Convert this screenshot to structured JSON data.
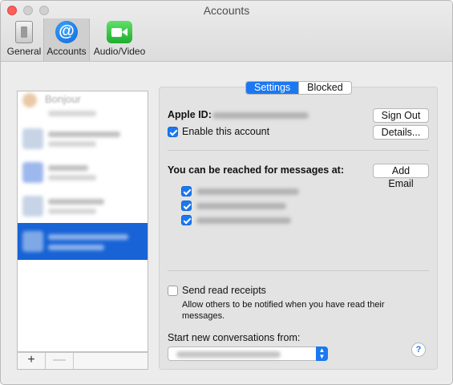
{
  "window": {
    "title": "Accounts"
  },
  "toolbar": {
    "items": [
      {
        "label": "General",
        "icon": "general-switch-icon"
      },
      {
        "label": "Accounts",
        "icon": "at-sign-icon",
        "selected": true
      },
      {
        "label": "Audio/Video",
        "icon": "video-camera-icon"
      }
    ]
  },
  "sidebar": {
    "accounts": [
      {
        "label": "Bonjour"
      },
      {},
      {},
      {},
      {},
      {
        "selected": true
      }
    ],
    "add_label": "+",
    "remove_label": "—"
  },
  "panel": {
    "tabs": [
      {
        "label": "Settings",
        "selected": true
      },
      {
        "label": "Blocked"
      }
    ],
    "apple_id_label": "Apple ID:",
    "sign_out_label": "Sign Out",
    "enable_account_label": "Enable this account",
    "enable_account_checked": true,
    "details_label": "Details...",
    "reached_label": "You can be reached for messages at:",
    "add_email_label": "Add Email",
    "reach_addresses_checked": [
      true,
      true,
      true
    ],
    "send_receipts_label": "Send read receipts",
    "send_receipts_checked": false,
    "receipts_desc": "Allow others to be notified when you have read their messages.",
    "start_conv_label": "Start new conversations from:",
    "help_label": "?"
  },
  "colors": {
    "accent": "#1b78f2",
    "selection": "#1863d6",
    "close": "#fc605c"
  }
}
